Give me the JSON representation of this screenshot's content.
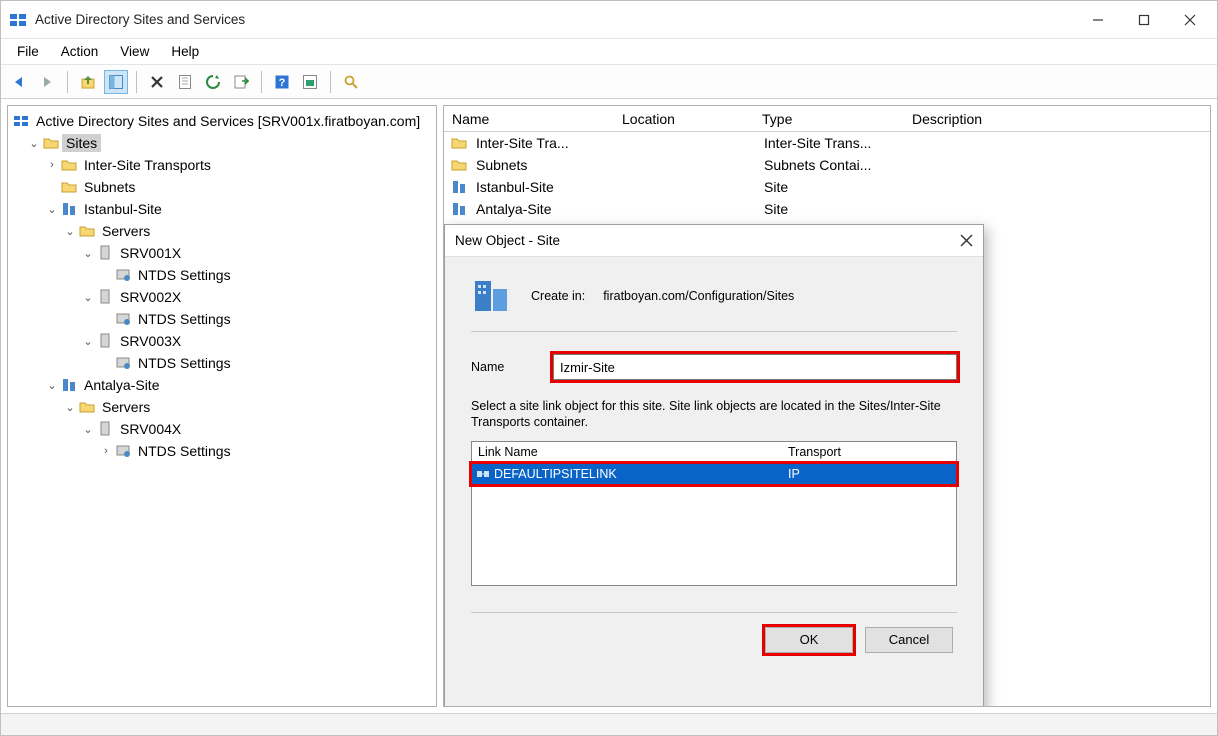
{
  "titlebar": {
    "title": "Active Directory Sites and Services"
  },
  "menu": {
    "file": "File",
    "action": "Action",
    "view": "View",
    "help": "Help"
  },
  "tree": {
    "root": "Active Directory Sites and Services [SRV001x.firatboyan.com]",
    "sites": "Sites",
    "intersite": "Inter-Site Transports",
    "subnets": "Subnets",
    "istanbul": "Istanbul-Site",
    "servers": "Servers",
    "srv001": "SRV001X",
    "srv002": "SRV002X",
    "srv003": "SRV003X",
    "srv004": "SRV004X",
    "ntds": "NTDS Settings",
    "antalya": "Antalya-Site"
  },
  "list": {
    "headers": {
      "name": "Name",
      "location": "Location",
      "type": "Type",
      "description": "Description"
    },
    "rows": [
      {
        "name": "Inter-Site Tra...",
        "type": "Inter-Site Trans...",
        "icon": "folder"
      },
      {
        "name": "Subnets",
        "type": "Subnets Contai...",
        "icon": "folder"
      },
      {
        "name": "Istanbul-Site",
        "type": "Site",
        "icon": "site"
      },
      {
        "name": "Antalya-Site",
        "type": "Site",
        "icon": "site"
      }
    ]
  },
  "dialog": {
    "title": "New Object - Site",
    "createin_label": "Create in:",
    "createin_path": "firatboyan.com/Configuration/Sites",
    "name_label": "Name",
    "name_value": "Izmir-Site",
    "message": "Select a site link object for this site. Site link objects are located in the Sites/Inter-Site Transports container.",
    "link_header_name": "Link Name",
    "link_header_transport": "Transport",
    "link_row_name": "DEFAULTIPSITELINK",
    "link_row_transport": "IP",
    "ok": "OK",
    "cancel": "Cancel"
  }
}
